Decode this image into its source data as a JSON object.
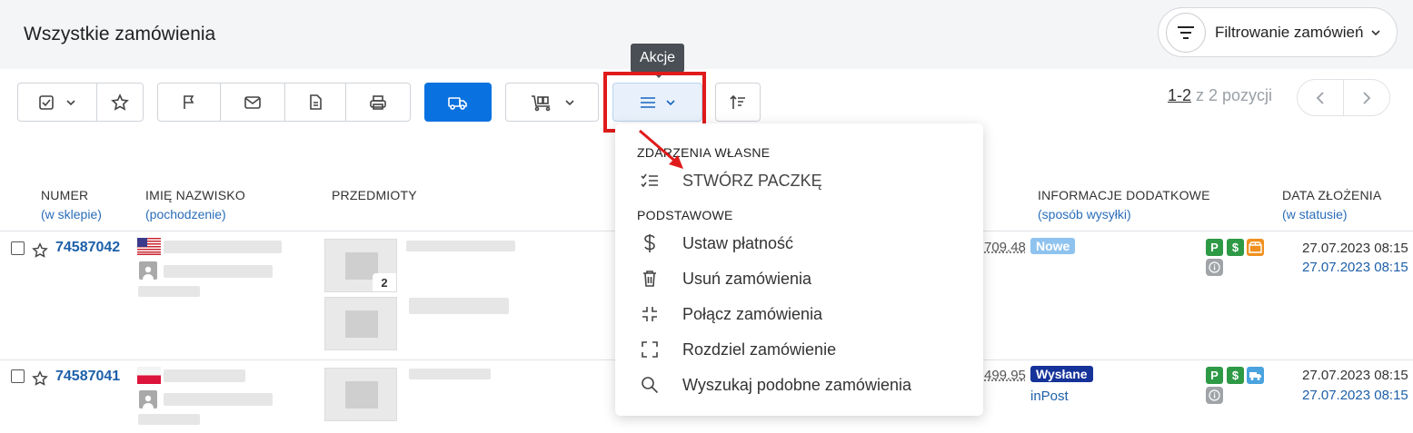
{
  "page": {
    "title": "Wszystkie zamówienia"
  },
  "filter": {
    "label": "Filtrowanie zamówień"
  },
  "tooltip": {
    "text": "Akcje"
  },
  "pagination": {
    "range": "1-2",
    "suffix": " z 2 pozycji"
  },
  "columns": {
    "numer": {
      "title": "NUMER",
      "sub": "(w sklepie)"
    },
    "imie": {
      "title": "IMIĘ NAZWISKO",
      "sub": "(pochodzenie)"
    },
    "przedmioty": {
      "title": "PRZEDMIOTY"
    },
    "info": {
      "title": "INFORMACJE DODATKOWE",
      "sub": "(sposób wysyłki)"
    },
    "data": {
      "title": "DATA ZŁOŻENIA",
      "sub": "(w statusie)"
    }
  },
  "menu": {
    "section1": "ZDARZENIA WŁASNE",
    "section2": "PODSTAWOWE",
    "items": [
      {
        "label": "STWÓRZ PACZKĘ",
        "icon": "checklist-icon"
      },
      {
        "label": "Ustaw płatność",
        "icon": "dollar-icon"
      },
      {
        "label": "Usuń zamówienia",
        "icon": "trash-icon"
      },
      {
        "label": "Połącz zamówienia",
        "icon": "merge-icon"
      },
      {
        "label": "Rozdziel zamówienie",
        "icon": "split-icon"
      },
      {
        "label": "Wyszukaj podobne zamówienia",
        "icon": "search-icon"
      }
    ]
  },
  "orders": [
    {
      "number": "74587042",
      "flag": "US",
      "qty": "2",
      "price": "709.48",
      "status": "Nowe",
      "status_color": "#8fc3ef",
      "shipping": "",
      "date1": "27.07.2023 08:15",
      "date2": "27.07.2023 08:15"
    },
    {
      "number": "74587041",
      "flag": "PL",
      "price": "499.95",
      "status": "Wysłane",
      "status_color": "#16339a",
      "shipping": "inPost",
      "date1": "27.07.2023 08:15",
      "date2": "27.07.2023 08:15"
    }
  ],
  "colors": {
    "primary": "#0a72e0",
    "highlight": "#e01b1b",
    "link": "#1d5fa8",
    "p_badge": "#2e9a46",
    "box_badge": "#f0901e",
    "truck_badge": "#4aa3df",
    "info_badge": "#a0a4a8"
  }
}
